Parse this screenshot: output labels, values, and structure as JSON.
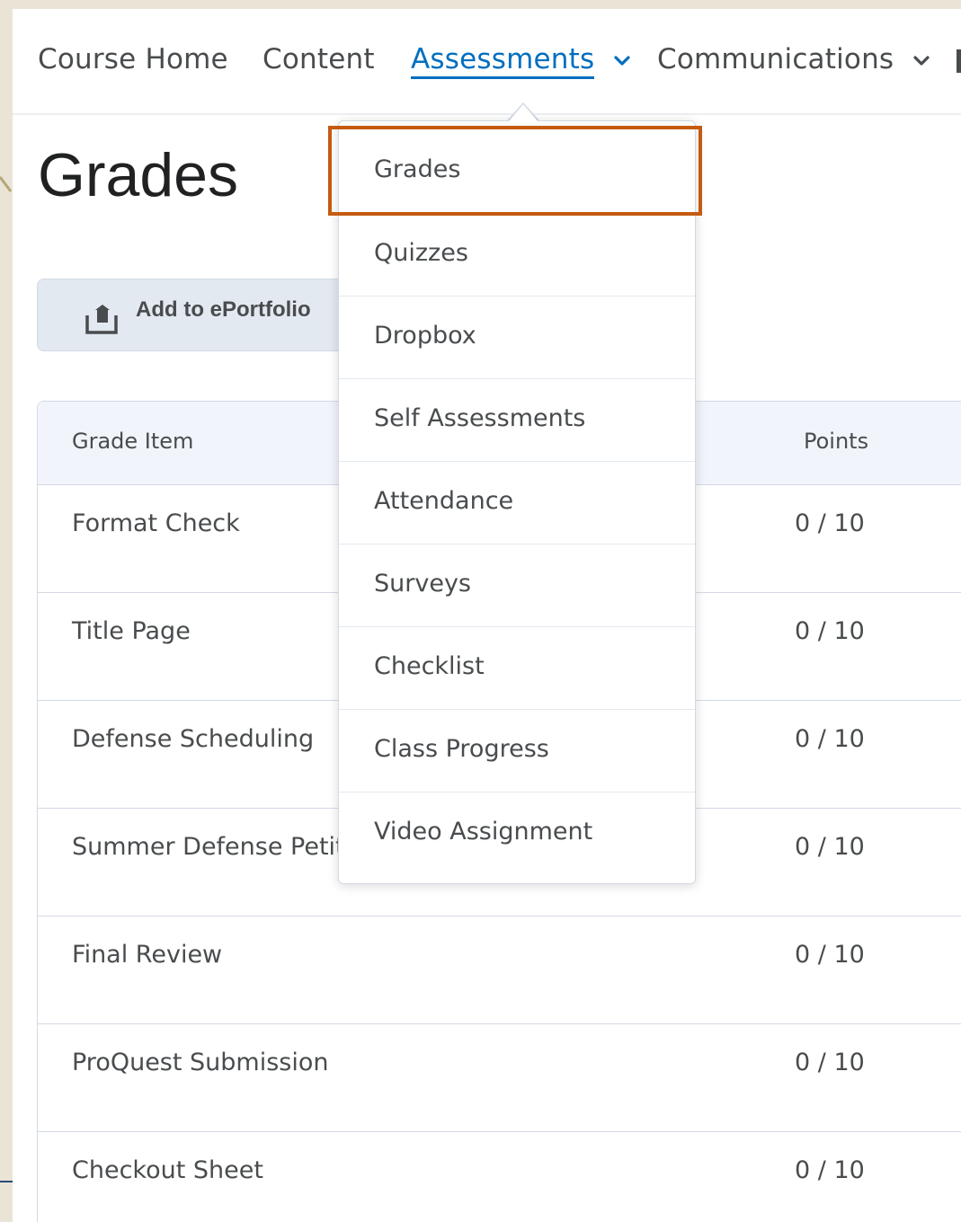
{
  "nav": {
    "items": [
      {
        "label": "Course Home",
        "has_dropdown": false,
        "active": false
      },
      {
        "label": "Content",
        "has_dropdown": false,
        "active": false
      },
      {
        "label": "Assessments",
        "has_dropdown": true,
        "active": true
      },
      {
        "label": "Communications",
        "has_dropdown": true,
        "active": false
      }
    ]
  },
  "page": {
    "title": "Grades",
    "add_button_label": "Add to ePortfolio",
    "add_button_icon": "eportfolio-upload-icon"
  },
  "table": {
    "headers": {
      "item": "Grade Item",
      "points": "Points"
    },
    "rows": [
      {
        "name": "Format Check",
        "points": "0 / 10"
      },
      {
        "name": "Title Page",
        "points": "0 / 10"
      },
      {
        "name": "Defense Scheduling",
        "points": "0 / 10"
      },
      {
        "name": "Summer Defense Petiti",
        "points": "0 / 10"
      },
      {
        "name": "Final Review",
        "points": "0 / 10"
      },
      {
        "name": "ProQuest Submission",
        "points": "0 / 10"
      },
      {
        "name": "Checkout Sheet",
        "points": "0 / 10"
      }
    ]
  },
  "dropdown": {
    "items": [
      "Grades",
      "Quizzes",
      "Dropbox",
      "Self Assessments",
      "Attendance",
      "Surveys",
      "Checklist",
      "Class Progress",
      "Video Assignment"
    ],
    "highlighted_item": "Grades"
  },
  "colors": {
    "accent": "#006fbf",
    "highlight": "#c55a11",
    "text": "#494c4e",
    "header_bg": "#f1f5fb"
  }
}
